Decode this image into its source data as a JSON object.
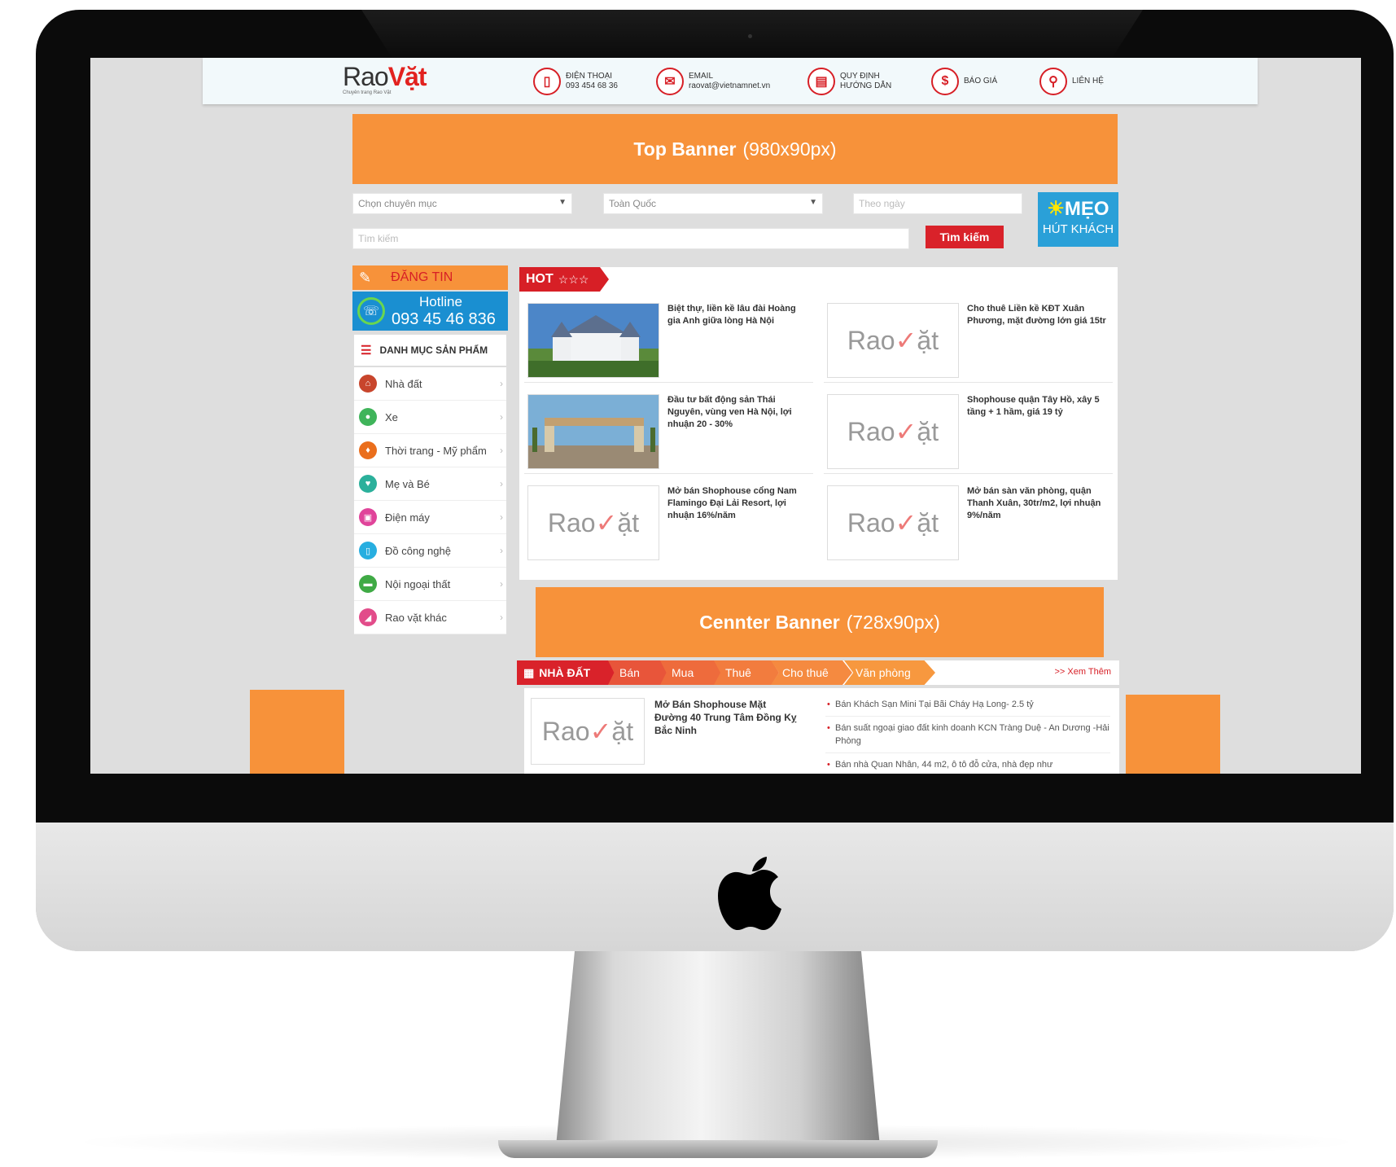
{
  "header": {
    "logo_main": "Rao",
    "logo_accent": "Vặt",
    "logo_tagline": "Chuyên trang Rao Vặt",
    "contacts": [
      {
        "icon": "phone-icon",
        "line1": "ĐIỆN THOẠI",
        "line2": "093 454 68 36"
      },
      {
        "icon": "email-icon",
        "line1": "EMAIL",
        "line2": "raovat@vietnamnet.vn"
      },
      {
        "icon": "document-icon",
        "line1": "QUY ĐỊNH",
        "line2": "HƯỚNG DẪN"
      },
      {
        "icon": "dollar-icon",
        "line1": "BÁO GIÁ",
        "line2": ""
      },
      {
        "icon": "location-icon",
        "line1": "LIÊN HỆ",
        "line2": ""
      }
    ]
  },
  "top_banner": {
    "title": "Top Banner",
    "size": "(980x90px)"
  },
  "search": {
    "category_select": "Chọn chuyên mục",
    "region_select": "Toàn Quốc",
    "date_placeholder": "Theo ngày",
    "keyword_placeholder": "Tìm kiếm",
    "button": "Tìm kiếm"
  },
  "meo": {
    "line1": "MẸO",
    "line2": "HÚT KHÁCH"
  },
  "sidebar": {
    "post_ad": "ĐĂNG TIN",
    "hotline_label": "Hotline",
    "hotline_number": "093 45 46 836",
    "catalog_title": "DANH MỤC SẢN PHẨM",
    "categories": [
      {
        "label": "Nhà đất",
        "color": "#c8452c"
      },
      {
        "label": "Xe",
        "color": "#3fb45a"
      },
      {
        "label": "Thời trang - Mỹ phẩm",
        "color": "#ea6e1c"
      },
      {
        "label": "Mẹ và Bé",
        "color": "#2bb09b"
      },
      {
        "label": "Điện máy",
        "color": "#e0449a"
      },
      {
        "label": "Đồ công nghệ",
        "color": "#27aee0"
      },
      {
        "label": "Nội ngoại thất",
        "color": "#3faa45"
      },
      {
        "label": "Rao vặt khác",
        "color": "#e24c8a"
      }
    ]
  },
  "hot": {
    "tag": "HOT",
    "stars": "☆☆☆",
    "items": [
      {
        "title": "Biệt thự, liền kề lâu đài Hoàng gia Anh giữa lòng Hà Nội",
        "image": "villa"
      },
      {
        "title": "Cho thuê Liền kề KĐT Xuân Phương, mặt đường lớn giá 15tr",
        "image": "placeholder"
      },
      {
        "title": "Đầu tư bất động sản Thái Nguyên, vùng ven Hà Nội, lợi nhuận 20 - 30%",
        "image": "gate"
      },
      {
        "title": "Shophouse quận Tây Hồ, xây 5 tầng + 1 hầm, giá 19 tỷ",
        "image": "placeholder"
      },
      {
        "title": "Mở bán Shophouse cổng Nam Flamingo Đại Lải Resort, lợi nhuận 16%/năm",
        "image": "placeholder"
      },
      {
        "title": "Mở bán sàn văn phòng, quận Thanh Xuân, 30tr/m2, lợi nhuận 9%/năm",
        "image": "placeholder"
      }
    ]
  },
  "center_banner": {
    "title": "Cennter Banner",
    "size": "(728x90px)"
  },
  "section": {
    "tabs": [
      "NHÀ ĐẤT",
      "Bán",
      "Mua",
      "Thuê",
      "Cho thuê",
      "Văn phòng"
    ],
    "more": ">> Xem Thêm",
    "featured_title": "Mở Bán Shophouse Mặt Đường 40 Trung Tâm Đồng Kỵ Bắc Ninh",
    "list": [
      "Bán Khách Sạn Mini Tại Bãi Cháy Hạ Long- 2.5 tỷ",
      "Bán suất ngoại giao đất kinh doanh KCN Tràng Duệ - An Dương -Hải Phòng",
      "Bán nhà Quan Nhân, 44 m2, ô tô đỗ cửa, nhà đẹp như"
    ]
  },
  "colors": {
    "orange": "#f7923a",
    "red": "#d71f26",
    "blue": "#1a8fd1"
  }
}
